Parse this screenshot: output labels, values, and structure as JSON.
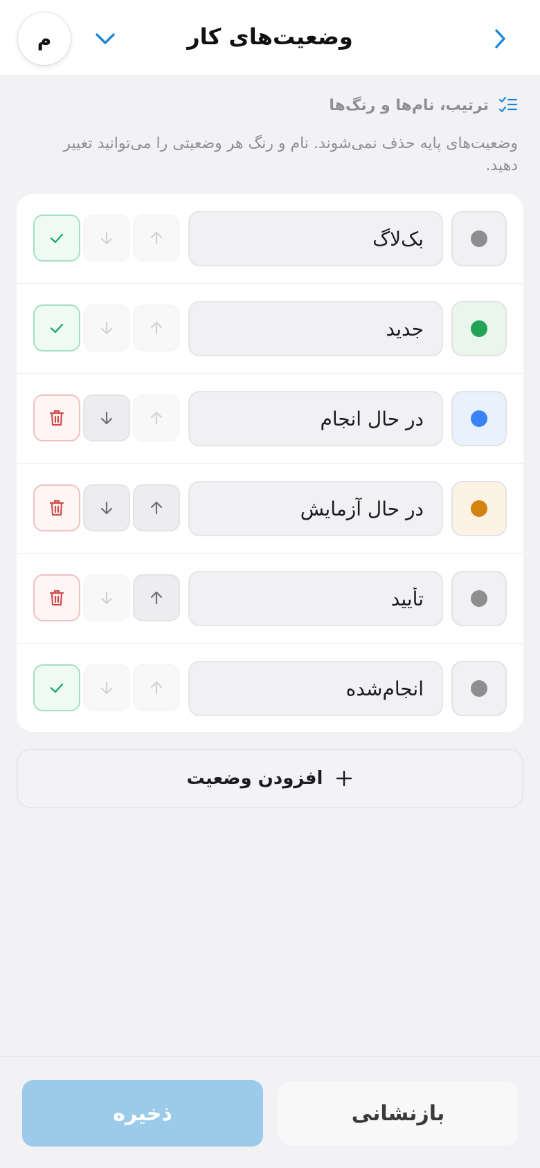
{
  "header": {
    "title": "وضعیت‌های کار",
    "avatar_letter": "م",
    "back_icon": "chevron-right-icon",
    "dropdown_icon": "chevron-down-icon"
  },
  "section": {
    "title": "ترتیب، نام‌ها و رنگ‌ها",
    "icon": "list-check-icon",
    "description": "وضعیت‌های پایه حذف نمی‌شوند. نام و رنگ هر وضعیتی را می‌توانید تغییر دهید."
  },
  "statuses": [
    {
      "name": "بک‌لاگ",
      "color": "#8e8e8e",
      "swatch_bg": "#f1f1f3",
      "up_enabled": false,
      "down_enabled": false,
      "action": "check"
    },
    {
      "name": "جدید",
      "color": "#22a355",
      "swatch_bg": "#e8f6ec",
      "up_enabled": false,
      "down_enabled": false,
      "action": "check"
    },
    {
      "name": "در حال انجام",
      "color": "#3b82f6",
      "swatch_bg": "#e9f1fd",
      "up_enabled": false,
      "down_enabled": true,
      "action": "delete"
    },
    {
      "name": "در حال آزمایش",
      "color": "#d38410",
      "swatch_bg": "#fdf3e4",
      "up_enabled": true,
      "down_enabled": true,
      "action": "delete"
    },
    {
      "name": "تأیید",
      "color": "#8e8e8e",
      "swatch_bg": "#f1f1f3",
      "up_enabled": true,
      "down_enabled": false,
      "action": "delete"
    },
    {
      "name": "انجام‌شده",
      "color": "#8e8e8e",
      "swatch_bg": "#f1f1f3",
      "up_enabled": false,
      "down_enabled": false,
      "action": "check"
    }
  ],
  "add_button": {
    "label": "افزودن وضعیت",
    "icon": "plus-icon"
  },
  "footer": {
    "save_label": "ذخیره",
    "reset_label": "بازنشانی"
  },
  "colors": {
    "accent": "#1e88d6",
    "save_disabled": "#9ccbea",
    "check": "#1fa872",
    "delete": "#d04b4b"
  }
}
